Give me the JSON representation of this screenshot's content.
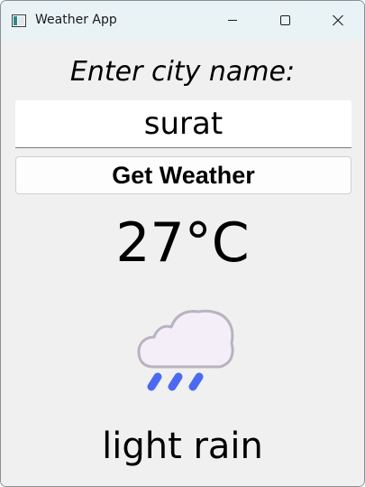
{
  "window": {
    "title": "Weather App",
    "app_icon": "app-window-icon",
    "controls": {
      "minimize_icon": "minimize-icon",
      "maximize_icon": "maximize-icon",
      "close_icon": "close-icon"
    }
  },
  "form": {
    "prompt": "Enter city name:",
    "city_value": "surat",
    "button_label": "Get Weather"
  },
  "result": {
    "temperature": "27°C",
    "icon": "light-rain-cloud-icon",
    "description": "light rain"
  },
  "colors": {
    "titlebar": "#e9f3f6",
    "background": "#f0f0f0",
    "rain_drops": "#4c6af0",
    "cloud_fill": "#f3eef8",
    "cloud_outline": "#b9b3bf"
  }
}
